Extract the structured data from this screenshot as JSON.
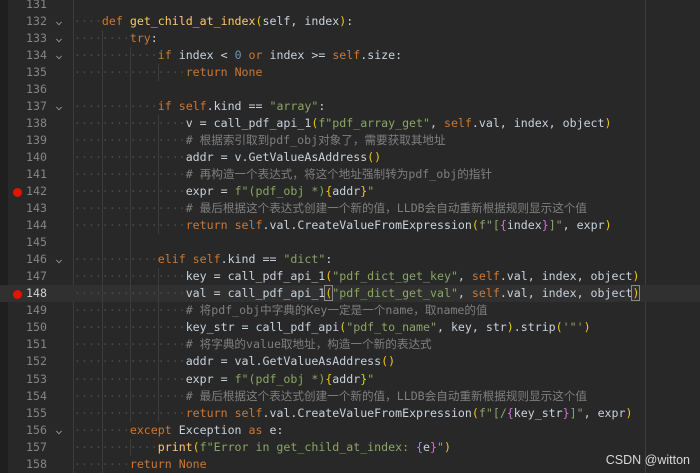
{
  "editor": {
    "current_line": 148,
    "lines": [
      {
        "num": 131,
        "indent": 0,
        "t": []
      },
      {
        "num": 132,
        "indent": 4,
        "fold": true,
        "t": [
          [
            "k",
            "def"
          ],
          [
            "i",
            " "
          ],
          [
            "f",
            "get_child_at_index"
          ],
          [
            "p",
            "("
          ],
          [
            "i",
            "self, index"
          ],
          [
            "p",
            ")"
          ],
          [
            "i",
            ":"
          ]
        ]
      },
      {
        "num": 133,
        "indent": 8,
        "fold": true,
        "t": [
          [
            "k",
            "try"
          ],
          [
            "i",
            ":"
          ]
        ]
      },
      {
        "num": 134,
        "indent": 12,
        "fold": true,
        "t": [
          [
            "k",
            "if"
          ],
          [
            "i",
            " index < "
          ],
          [
            "n",
            "0"
          ],
          [
            "i",
            " "
          ],
          [
            "k",
            "or"
          ],
          [
            "i",
            " index >= "
          ],
          [
            "k",
            "self"
          ],
          [
            "i",
            ".size:"
          ]
        ]
      },
      {
        "num": 135,
        "indent": 16,
        "t": [
          [
            "k",
            "return"
          ],
          [
            "i",
            " "
          ],
          [
            "k",
            "None"
          ]
        ]
      },
      {
        "num": 136,
        "indent": 0,
        "t": []
      },
      {
        "num": 137,
        "indent": 12,
        "fold": true,
        "t": [
          [
            "k",
            "if"
          ],
          [
            "i",
            " "
          ],
          [
            "k",
            "self"
          ],
          [
            "i",
            ".kind == "
          ],
          [
            "s",
            "\"array\""
          ],
          [
            "i",
            ":"
          ]
        ]
      },
      {
        "num": 138,
        "indent": 16,
        "t": [
          [
            "i",
            "v = call_pdf_api_1"
          ],
          [
            "p",
            "("
          ],
          [
            "s",
            "f\"pdf_array_get\""
          ],
          [
            "i",
            ", "
          ],
          [
            "k",
            "self"
          ],
          [
            "i",
            ".val, index, object"
          ],
          [
            "p",
            ")"
          ]
        ]
      },
      {
        "num": 139,
        "indent": 16,
        "t": [
          [
            "c",
            "# 根据索引取到pdf_obj对象了，需要获取其地址"
          ]
        ]
      },
      {
        "num": 140,
        "indent": 16,
        "t": [
          [
            "i",
            "addr = v.GetValueAsAddress"
          ],
          [
            "p",
            "()"
          ]
        ]
      },
      {
        "num": 141,
        "indent": 16,
        "t": [
          [
            "c",
            "# 再构造一个表达式，将这个地址强制转为pdf_obj的指针"
          ]
        ]
      },
      {
        "num": 142,
        "indent": 16,
        "bp": true,
        "t": [
          [
            "i",
            "expr = "
          ],
          [
            "s",
            "f\"(pdf_obj *)"
          ],
          [
            "p",
            "{"
          ],
          [
            "i",
            "addr"
          ],
          [
            "p",
            "}"
          ],
          [
            "s",
            "\""
          ]
        ]
      },
      {
        "num": 143,
        "indent": 16,
        "t": [
          [
            "c",
            "# 最后根据这个表达式创建一个新的值，LLDB会自动重新根据规则显示这个值"
          ]
        ]
      },
      {
        "num": 144,
        "indent": 16,
        "t": [
          [
            "k",
            "return"
          ],
          [
            "i",
            " "
          ],
          [
            "k",
            "self"
          ],
          [
            "i",
            ".val.CreateValueFromExpression"
          ],
          [
            "p",
            "("
          ],
          [
            "s",
            "f\"["
          ],
          [
            "b",
            "{"
          ],
          [
            "i",
            "index"
          ],
          [
            "b",
            "}"
          ],
          [
            "s",
            "]\""
          ],
          [
            "i",
            ", expr"
          ],
          [
            "p",
            ")"
          ]
        ]
      },
      {
        "num": 145,
        "indent": 0,
        "t": []
      },
      {
        "num": 146,
        "indent": 12,
        "fold": true,
        "t": [
          [
            "k",
            "elif"
          ],
          [
            "i",
            " "
          ],
          [
            "k",
            "self"
          ],
          [
            "i",
            ".kind == "
          ],
          [
            "s",
            "\"dict\""
          ],
          [
            "i",
            ":"
          ]
        ]
      },
      {
        "num": 147,
        "indent": 16,
        "t": [
          [
            "i",
            "key = call_pdf_api_1"
          ],
          [
            "p",
            "("
          ],
          [
            "s",
            "\"pdf_dict_get_key\""
          ],
          [
            "i",
            ", "
          ],
          [
            "k",
            "self"
          ],
          [
            "i",
            ".val, index, object"
          ],
          [
            "p",
            ")"
          ]
        ]
      },
      {
        "num": 148,
        "indent": 16,
        "bp": true,
        "t": [
          [
            "i",
            "val = call_pdf_api_1"
          ],
          [
            "p box",
            "("
          ],
          [
            "s",
            "\"pdf_dict_get_val\""
          ],
          [
            "i",
            ", "
          ],
          [
            "k",
            "self"
          ],
          [
            "i",
            ".val, index, object"
          ],
          [
            "p box",
            ")"
          ]
        ]
      },
      {
        "num": 149,
        "indent": 16,
        "t": [
          [
            "c",
            "# 将pdf_obj中字典的Key一定是一个name，取name的值"
          ]
        ]
      },
      {
        "num": 150,
        "indent": 16,
        "t": [
          [
            "i",
            "key_str = call_pdf_api"
          ],
          [
            "p",
            "("
          ],
          [
            "s",
            "\"pdf_to_name\""
          ],
          [
            "i",
            ", key, str"
          ],
          [
            "p",
            ")"
          ],
          [
            "i",
            ".strip"
          ],
          [
            "p",
            "("
          ],
          [
            "s",
            "'\"'"
          ],
          [
            "p",
            ")"
          ]
        ]
      },
      {
        "num": 151,
        "indent": 16,
        "t": [
          [
            "c",
            "# 将字典的value取地址，构造一个新的表达式"
          ]
        ]
      },
      {
        "num": 152,
        "indent": 16,
        "t": [
          [
            "i",
            "addr = val.GetValueAsAddress"
          ],
          [
            "p",
            "()"
          ]
        ]
      },
      {
        "num": 153,
        "indent": 16,
        "t": [
          [
            "i",
            "expr = "
          ],
          [
            "s",
            "f\"(pdf_obj *)"
          ],
          [
            "p",
            "{"
          ],
          [
            "i",
            "addr"
          ],
          [
            "p",
            "}"
          ],
          [
            "s",
            "\""
          ]
        ]
      },
      {
        "num": 154,
        "indent": 16,
        "t": [
          [
            "c",
            "# 最后根据这个表达式创建一个新的值，LLDB会自动重新根据规则显示这个值"
          ]
        ]
      },
      {
        "num": 155,
        "indent": 16,
        "t": [
          [
            "k",
            "return"
          ],
          [
            "i",
            " "
          ],
          [
            "k",
            "self"
          ],
          [
            "i",
            ".val.CreateValueFromExpression"
          ],
          [
            "p",
            "("
          ],
          [
            "s",
            "f\"[/"
          ],
          [
            "b",
            "{"
          ],
          [
            "i",
            "key_str"
          ],
          [
            "b",
            "}"
          ],
          [
            "s",
            "]\""
          ],
          [
            "i",
            ", expr"
          ],
          [
            "p",
            ")"
          ]
        ]
      },
      {
        "num": 156,
        "indent": 8,
        "fold": true,
        "t": [
          [
            "k",
            "except"
          ],
          [
            "i",
            " Exception "
          ],
          [
            "k",
            "as"
          ],
          [
            "i",
            " e:"
          ]
        ]
      },
      {
        "num": 157,
        "indent": 12,
        "t": [
          [
            "f",
            "print"
          ],
          [
            "p",
            "("
          ],
          [
            "s",
            "f\"Error in get_child_at_index: "
          ],
          [
            "b",
            "{"
          ],
          [
            "i",
            "e"
          ],
          [
            "b",
            "}"
          ],
          [
            "s",
            "\""
          ],
          [
            "p",
            ")"
          ]
        ]
      },
      {
        "num": 158,
        "indent": 8,
        "t": [
          [
            "k",
            "return"
          ],
          [
            "i",
            " "
          ],
          [
            "k",
            "None"
          ]
        ]
      }
    ]
  },
  "watermark": "CSDN @witton"
}
